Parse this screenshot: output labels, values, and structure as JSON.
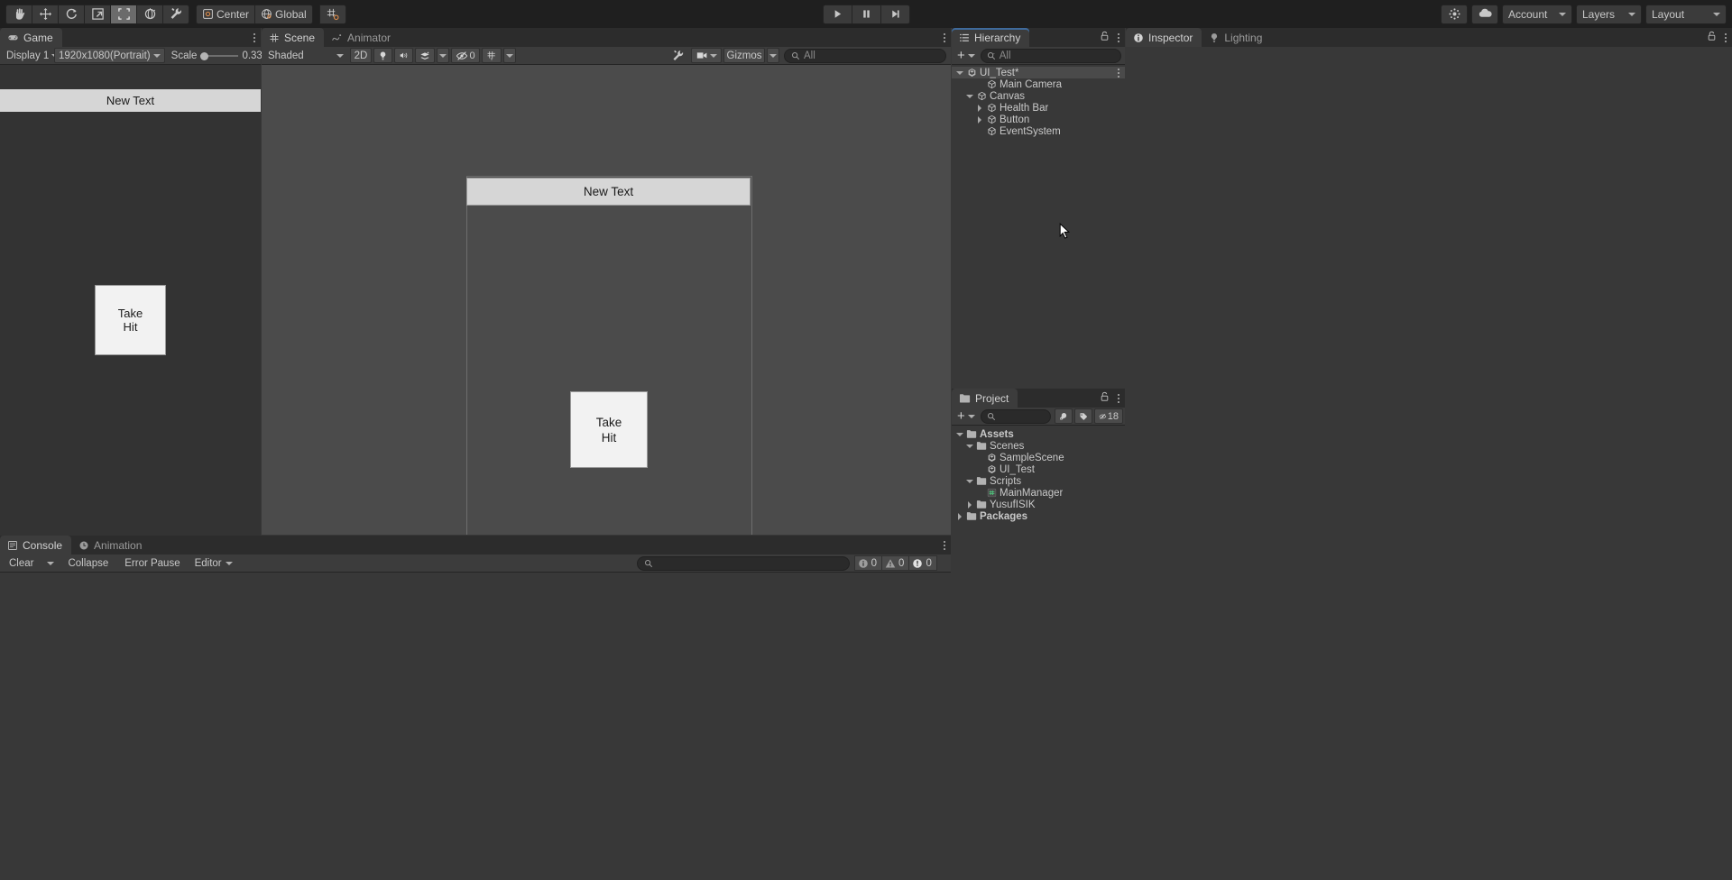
{
  "toolbar": {
    "tools": [
      {
        "name": "hand-tool",
        "icon": "hand-icon",
        "active": false
      },
      {
        "name": "move-tool",
        "icon": "move-icon",
        "active": false
      },
      {
        "name": "rotate-tool",
        "icon": "rotate-icon",
        "active": false
      },
      {
        "name": "scale-tool",
        "icon": "scale-icon",
        "active": false
      },
      {
        "name": "rect-tool",
        "icon": "rect-transform-icon",
        "active": true
      },
      {
        "name": "transform-tool",
        "icon": "transform-icon",
        "active": false
      },
      {
        "name": "custom-tool",
        "icon": "wrench-icon",
        "active": false
      }
    ],
    "pivot_label": "Center",
    "handle_label": "Global",
    "snap_label": "grid-snap",
    "play_label": "play-icon",
    "pause_label": "pause-icon",
    "step_label": "step-icon",
    "search_placeholder": "",
    "account_label": "Account",
    "layers_label": "Layers",
    "layout_label": "Layout",
    "collab_label": "cloud-icon",
    "services_label": "services-icon"
  },
  "game": {
    "tab_label": "Game",
    "display_label": "Display 1",
    "resolution_label": "1920x1080(Portrait)",
    "scale_label": "Scale",
    "scale_value": "0.33x",
    "text_bar": "New Text",
    "button_line1": "Take",
    "button_line2": "Hit"
  },
  "scene": {
    "tab_label": "Scene",
    "tab2_label": "Animator",
    "shading_label": "Shaded",
    "twod_label": "2D",
    "light_label": "lighting-icon",
    "audio_label": "audio-icon",
    "fx_label": "effects-icon",
    "hidden_count": "0",
    "grid_label": "grid-icon",
    "tools_label": "scene-tools-icon",
    "camera_label": "scene-camera-icon",
    "gizmos_label": "Gizmos",
    "search_placeholder": "All",
    "text_bar": "New Text",
    "button_line1": "Take",
    "button_line2": "Hit"
  },
  "console": {
    "tab_label": "Console",
    "tab2_label": "Animation",
    "clear_label": "Clear",
    "collapse_label": "Collapse",
    "error_pause_label": "Error Pause",
    "editor_label": "Editor",
    "search_placeholder": "",
    "log_count": "0",
    "warn_count": "0",
    "error_count": "0"
  },
  "hierarchy": {
    "tab_label": "Hierarchy",
    "add_label": "+",
    "search_placeholder": "All",
    "items": [
      {
        "label": "UI_Test*",
        "depth": 0,
        "icon": "unity-scene-icon",
        "twist": "open",
        "selected": true,
        "kebab": true
      },
      {
        "label": "Main Camera",
        "depth": 2,
        "icon": "gameobject-icon",
        "twist": "none",
        "selected": false,
        "kebab": false
      },
      {
        "label": "Canvas",
        "depth": 1,
        "icon": "gameobject-icon",
        "twist": "open",
        "selected": false,
        "kebab": false
      },
      {
        "label": "Health Bar",
        "depth": 2,
        "icon": "gameobject-icon",
        "twist": "closed",
        "selected": false,
        "kebab": false
      },
      {
        "label": "Button",
        "depth": 2,
        "icon": "gameobject-icon",
        "twist": "closed",
        "selected": false,
        "kebab": false
      },
      {
        "label": "EventSystem",
        "depth": 2,
        "icon": "gameobject-icon",
        "twist": "none",
        "selected": false,
        "kebab": false
      }
    ]
  },
  "project": {
    "tab_label": "Project",
    "add_label": "+",
    "search_placeholder": "",
    "filter_type_label": "type-filter-icon",
    "filter_label_label": "label-filter-icon",
    "hidden_count": "18",
    "items": [
      {
        "label": "Assets",
        "depth": 0,
        "icon": "folder-icon",
        "twist": "open",
        "bold": true
      },
      {
        "label": "Scenes",
        "depth": 1,
        "icon": "folder-icon",
        "twist": "open",
        "bold": false
      },
      {
        "label": "SampleScene",
        "depth": 2,
        "icon": "unity-scene-icon",
        "twist": "none",
        "bold": false
      },
      {
        "label": "UI_Test",
        "depth": 2,
        "icon": "unity-scene-icon",
        "twist": "none",
        "bold": false
      },
      {
        "label": "Scripts",
        "depth": 1,
        "icon": "folder-icon",
        "twist": "open",
        "bold": false
      },
      {
        "label": "MainManager",
        "depth": 2,
        "icon": "cs-script-icon",
        "twist": "none",
        "bold": false
      },
      {
        "label": "YusufISIK",
        "depth": 1,
        "icon": "folder-icon",
        "twist": "closed",
        "bold": false
      },
      {
        "label": "Packages",
        "depth": 0,
        "icon": "folder-icon",
        "twist": "closed",
        "bold": true
      }
    ]
  },
  "inspector": {
    "tab_label": "Inspector",
    "tab2_label": "Lighting"
  },
  "colors": {
    "accent_blue": "#3e6a9c",
    "panel_bg": "#383838",
    "toolbar_bg": "#1f1f1f",
    "tab_bg": "#2c2c2c",
    "selected_row": "#4a4a4a",
    "ui_white": "#f2f2f2",
    "ui_light_gray": "#d6d6d6"
  }
}
